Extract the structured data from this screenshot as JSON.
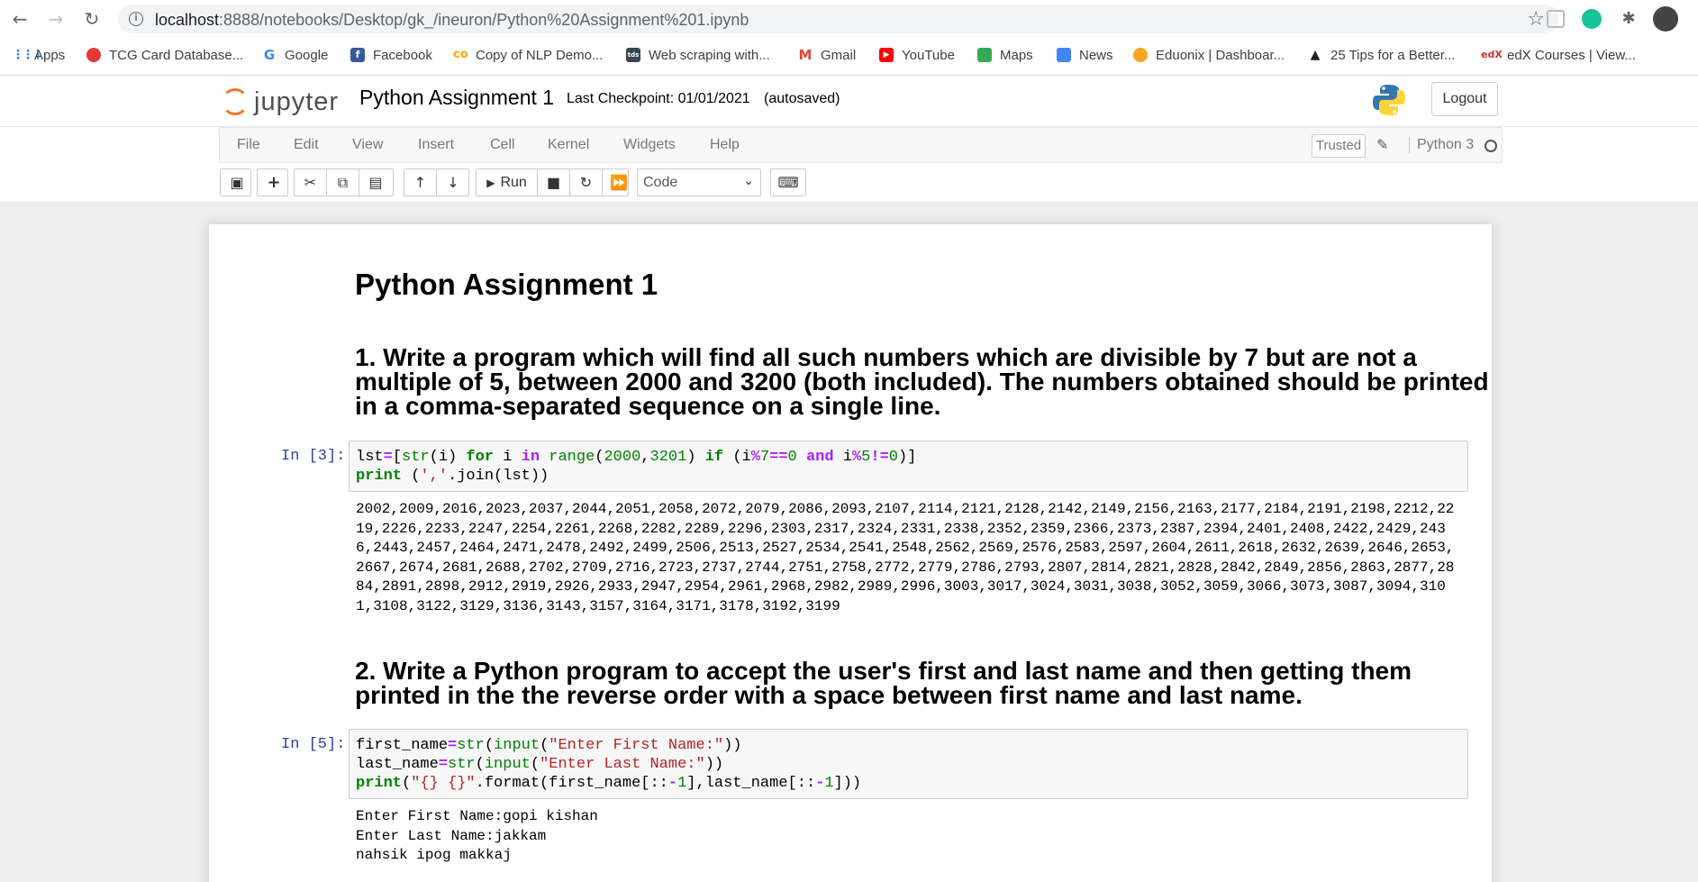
{
  "browser": {
    "url_host": "localhost",
    "url_path": ":8888/notebooks/Desktop/gk_/ineuron/Python%20Assignment%201.ipynb",
    "bookmarks": [
      {
        "label": "Apps",
        "color": "#4285f4"
      },
      {
        "label": "TCG Card Database...",
        "color": "#e53935"
      },
      {
        "label": "Google",
        "color": "#4285f4"
      },
      {
        "label": "Facebook",
        "color": "#3b5998"
      },
      {
        "label": "Copy of NLP Demo...",
        "color": "#f9ab00"
      },
      {
        "label": "Web scraping with...",
        "color": "#37474f"
      },
      {
        "label": "Gmail",
        "color": "#ea4335"
      },
      {
        "label": "YouTube",
        "color": "#ff0000"
      },
      {
        "label": "Maps",
        "color": "#34a853"
      },
      {
        "label": "News",
        "color": "#4285f4"
      },
      {
        "label": "Eduonix | Dashboar...",
        "color": "#f5a623"
      },
      {
        "label": "25 Tips for a Better...",
        "color": "#222222"
      },
      {
        "label": "edX Courses | View...",
        "color": "#d23228"
      }
    ],
    "bookmark_icons": {
      "tds": "tds",
      "edx": "edX",
      "apps": "⋮⋮⋮"
    }
  },
  "jupyter": {
    "logo_text": "jupyter",
    "notebook_name": "Python Assignment 1",
    "checkpoint": "Last Checkpoint: 01/01/2021",
    "autosave": "(autosaved)",
    "logout_label": "Logout",
    "menus": [
      "File",
      "Edit",
      "View",
      "Insert",
      "Cell",
      "Kernel",
      "Widgets",
      "Help"
    ],
    "trusted_label": "Trusted",
    "kernel_name": "Python 3",
    "run_label": "Run",
    "cell_type": "Code"
  },
  "notebook": {
    "title": "Python Assignment 1",
    "q1": "1. Write a program which will find all such numbers which are divisible by 7 but are not a multiple of 5, between 2000 and 3200 (both included). The numbers obtained should be printed in a comma-separated sequence on a single line.",
    "cell1_prompt": "In [3]:",
    "cell1_output": [
      "2002,2009,2016,2023,2037,2044,2051,2058,2072,2079,2086,2093,2107,2114,2121,2128,2142,2149,2156,2163,2177,2184,2191,2198,2212,22",
      "19,2226,2233,2247,2254,2261,2268,2282,2289,2296,2303,2317,2324,2331,2338,2352,2359,2366,2373,2387,2394,2401,2408,2422,2429,243",
      "6,2443,2457,2464,2471,2478,2492,2499,2506,2513,2527,2534,2541,2548,2562,2569,2576,2583,2597,2604,2611,2618,2632,2639,2646,2653,",
      "2667,2674,2681,2688,2702,2709,2716,2723,2737,2744,2751,2758,2772,2779,2786,2793,2807,2814,2821,2828,2842,2849,2856,2863,2877,28",
      "84,2891,2898,2912,2919,2926,2933,2947,2954,2961,2968,2982,2989,2996,3003,3017,3024,3031,3038,3052,3059,3066,3073,3087,3094,310",
      "1,3108,3122,3129,3136,3143,3157,3164,3171,3178,3192,3199"
    ],
    "q2": "2. Write a Python program to accept the user's first and last name and then getting them printed in the the reverse order with a space between first name and last name.",
    "cell2_prompt": "In [5]:",
    "cell2_output": [
      "Enter First Name:gopi kishan",
      "Enter Last Name:jakkam",
      "nahsik ipog makkaj"
    ]
  },
  "colors": {
    "keyword": "#008000",
    "operator": "#aa22ff",
    "string": "#ba2121",
    "prompt": "#303f9f",
    "jupyter_orange": "#f37726"
  }
}
